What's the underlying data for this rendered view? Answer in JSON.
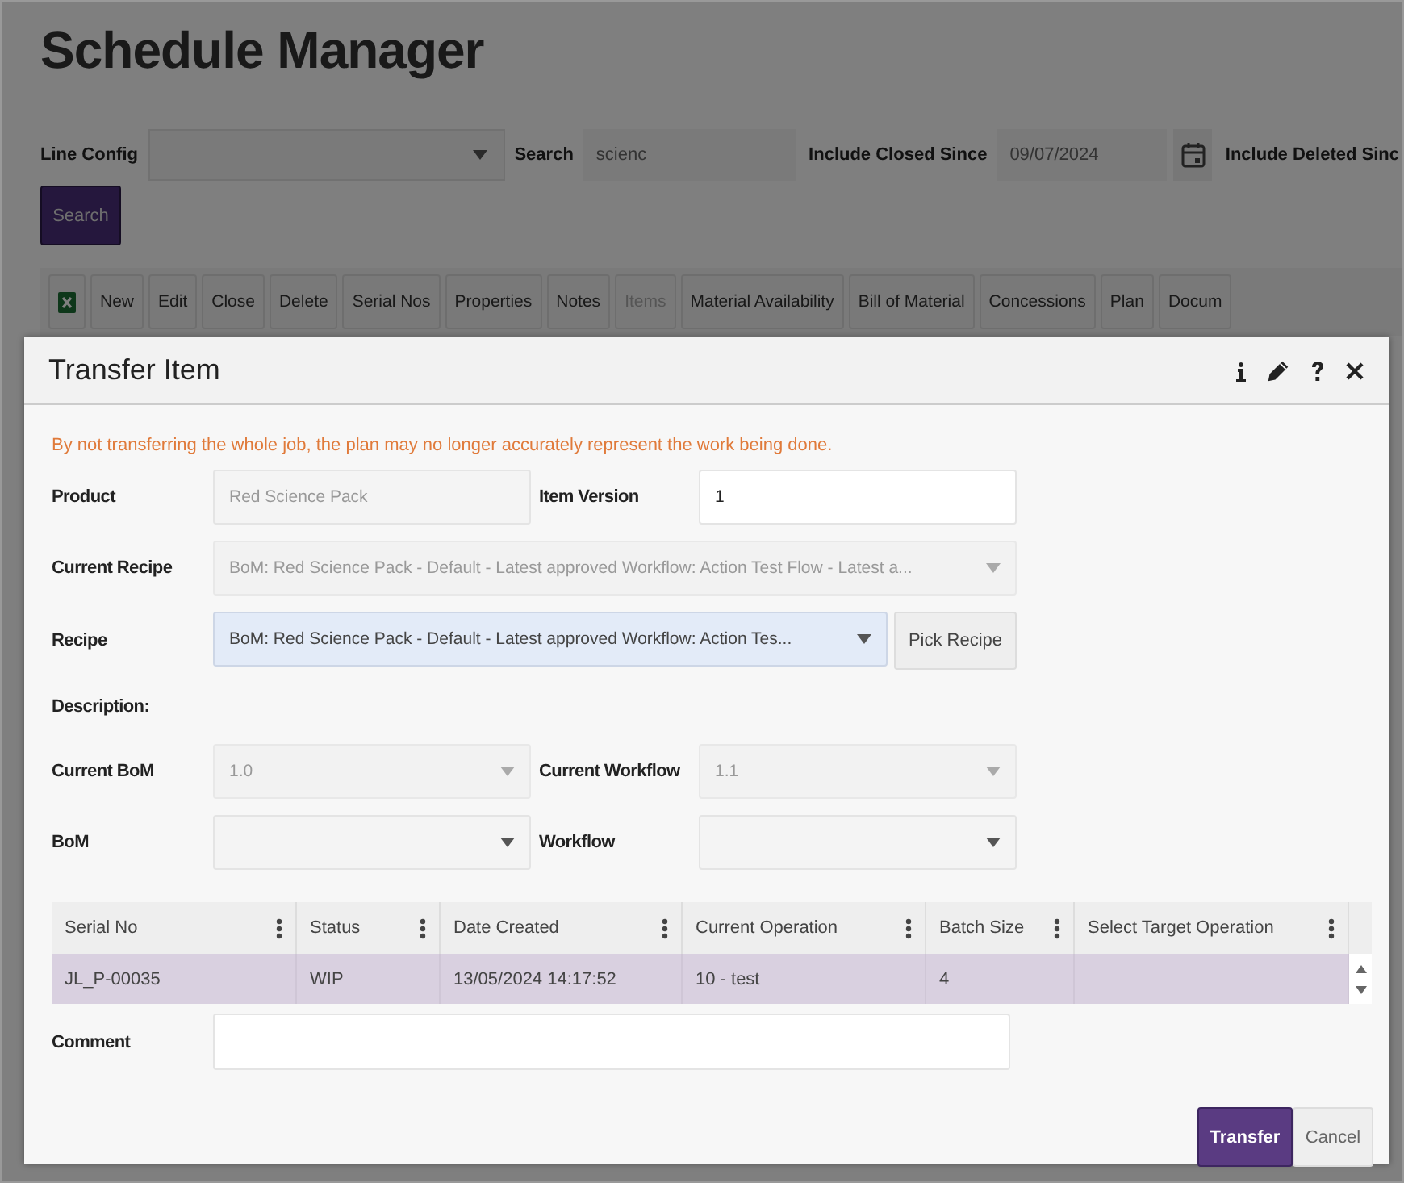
{
  "page": {
    "title": "Schedule Manager",
    "filters": [
      {
        "kind": "select",
        "label": "Line Config"
      },
      {
        "kind": "text",
        "label": "Search",
        "value": "scienc"
      },
      {
        "kind": "date",
        "label": "Include Closed Since",
        "value": "09/07/2024"
      },
      {
        "kind": "label",
        "label": "Include Deleted Sinc"
      }
    ],
    "search_button": "Search",
    "toolbar": [
      {
        "kind": "excel",
        "disabled": false
      },
      {
        "kind": "button",
        "label": "New",
        "disabled": false
      },
      {
        "kind": "button",
        "label": "Edit",
        "disabled": false
      },
      {
        "kind": "button",
        "label": "Close",
        "disabled": false
      },
      {
        "kind": "button",
        "label": "Delete",
        "disabled": false
      },
      {
        "kind": "button",
        "label": "Serial Nos",
        "disabled": false
      },
      {
        "kind": "button",
        "label": "Properties",
        "disabled": false
      },
      {
        "kind": "button",
        "label": "Notes",
        "disabled": false
      },
      {
        "kind": "button",
        "label": "Items",
        "disabled": true
      },
      {
        "kind": "button",
        "label": "Material Availability",
        "disabled": false
      },
      {
        "kind": "button",
        "label": "Bill of Material",
        "disabled": false
      },
      {
        "kind": "button",
        "label": "Concessions",
        "disabled": false
      },
      {
        "kind": "button",
        "label": "Plan",
        "disabled": false
      },
      {
        "kind": "button",
        "label": "Docum",
        "disabled": false
      }
    ]
  },
  "dialog": {
    "title": "Transfer Item",
    "header_icons": [
      {
        "kind": "info"
      },
      {
        "kind": "edit"
      },
      {
        "kind": "help"
      },
      {
        "kind": "close"
      }
    ],
    "warning": "By not transferring the whole job, the plan may no longer accurately represent the work being done.",
    "rows": [
      {
        "fields": [
          {
            "label": "Product",
            "kind": "text",
            "value": "Red Science Pack",
            "disabled": true
          },
          {
            "label": "Item Version",
            "kind": "text",
            "value": "1",
            "disabled": false
          }
        ]
      },
      {
        "fields": [
          {
            "label": "Current Recipe",
            "kind": "select",
            "value": "BoM: Red Science Pack - Default - Latest approved Workflow: Action Test Flow - Latest a...",
            "disabled": true
          }
        ]
      },
      {
        "fields": [
          {
            "label": "Recipe",
            "kind": "select",
            "value": "BoM: Red Science Pack - Default - Latest approved Workflow: Action Tes...",
            "disabled": false,
            "focused": true,
            "button": "Pick Recipe"
          }
        ]
      },
      {
        "fields": [
          {
            "label": "Description:",
            "kind": "none"
          }
        ]
      },
      {
        "fields": [
          {
            "label": "Current BoM",
            "kind": "select",
            "value": "1.0",
            "disabled": true
          },
          {
            "label": "Current Workflow",
            "kind": "select",
            "value": "1.1",
            "disabled": true
          }
        ]
      },
      {
        "fields": [
          {
            "label": "BoM",
            "kind": "select",
            "disabled": false
          },
          {
            "label": "Workflow",
            "kind": "select",
            "disabled": false
          }
        ]
      }
    ],
    "table": {
      "columns": [
        "Serial No",
        "Status",
        "Date Created",
        "Current Operation",
        "Batch Size",
        "Select Target Operation"
      ],
      "rows": [
        {
          "cells": [
            "JL_P-00035",
            "WIP",
            "13/05/2024 14:17:52",
            "10 - test",
            "4",
            ""
          ],
          "selected": true
        }
      ]
    },
    "comment_label": "Comment",
    "buttons": [
      {
        "label": "Transfer",
        "kind": "primary"
      },
      {
        "label": "Cancel",
        "kind": "secondary"
      }
    ]
  }
}
